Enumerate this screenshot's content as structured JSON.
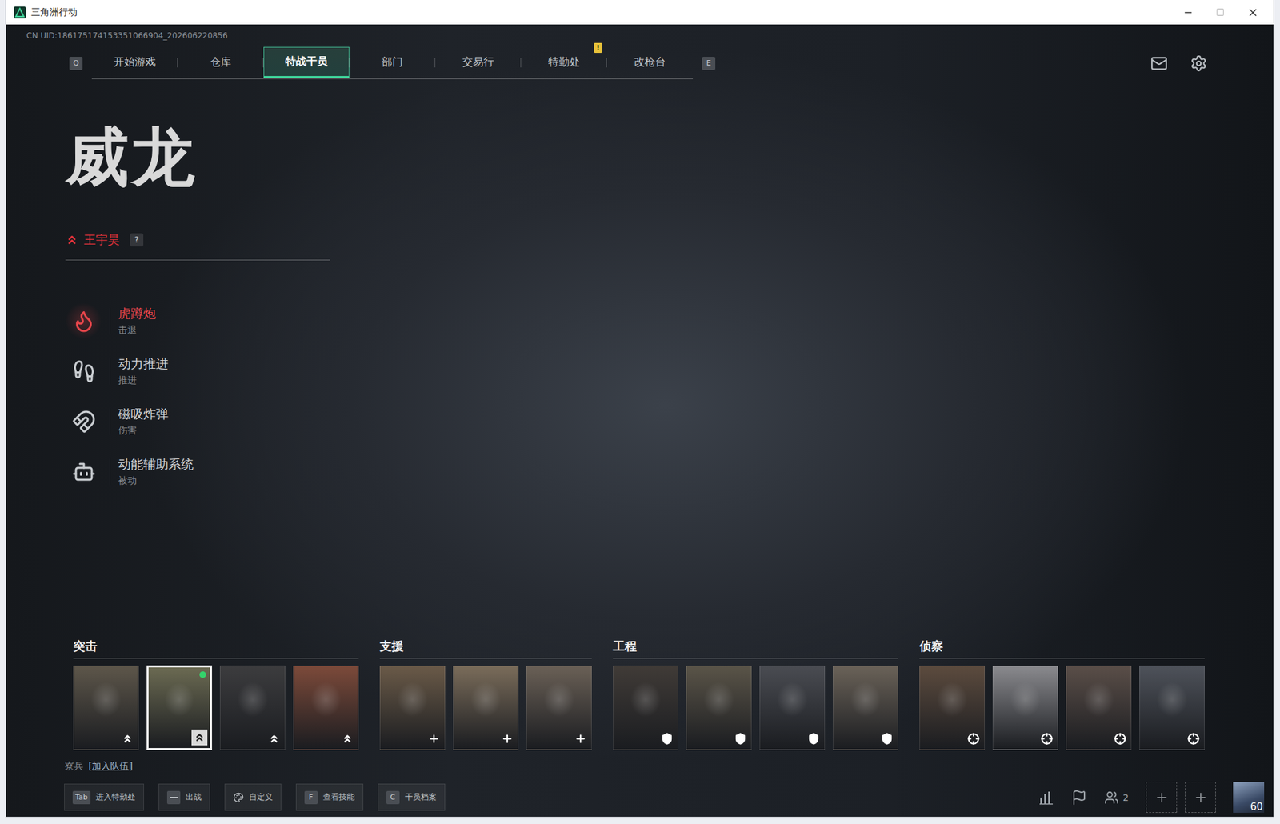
{
  "window": {
    "title": "三角洲行动"
  },
  "uid": "CN UID:186175174153351066904_202606220856",
  "nav": {
    "prev_key": "Q",
    "next_key": "E",
    "tabs": [
      {
        "label": "开始游戏",
        "selected": false,
        "badge": ""
      },
      {
        "label": "仓库",
        "selected": false,
        "badge": ""
      },
      {
        "label": "特战干员",
        "selected": true,
        "badge": ""
      },
      {
        "label": "部门",
        "selected": false,
        "badge": ""
      },
      {
        "label": "交易行",
        "selected": false,
        "badge": ""
      },
      {
        "label": "特勤处",
        "selected": false,
        "badge": "!"
      },
      {
        "label": "改枪台",
        "selected": false,
        "badge": ""
      }
    ]
  },
  "operator": {
    "name": "威龙",
    "real_name": "王宇昊",
    "help": "?",
    "skills": [
      {
        "name": "虎蹲炮",
        "type": "击退",
        "selected": true
      },
      {
        "name": "动力推进",
        "type": "推进",
        "selected": false
      },
      {
        "name": "磁吸炸弹",
        "type": "伤害",
        "selected": false
      },
      {
        "name": "动能辅助系统",
        "type": "被动",
        "selected": false
      }
    ]
  },
  "roster": {
    "groups": [
      {
        "label": "突击",
        "kind": "assault",
        "operators": [
          {
            "selected": false,
            "marked": false,
            "color": "#5d564a"
          },
          {
            "selected": true,
            "marked": true,
            "color": "#6b6a52"
          },
          {
            "selected": false,
            "marked": false,
            "color": "#3c3c3e"
          },
          {
            "selected": false,
            "marked": false,
            "color": "#7c4a3a"
          }
        ]
      },
      {
        "label": "支援",
        "kind": "support",
        "operators": [
          {
            "selected": false,
            "marked": false,
            "color": "#6a5a48"
          },
          {
            "selected": false,
            "marked": false,
            "color": "#7a6c5a"
          },
          {
            "selected": false,
            "marked": false,
            "color": "#6a6056"
          }
        ]
      },
      {
        "label": "工程",
        "kind": "engineer",
        "operators": [
          {
            "selected": false,
            "marked": false,
            "color": "#403b37"
          },
          {
            "selected": false,
            "marked": false,
            "color": "#5a5448"
          },
          {
            "selected": false,
            "marked": false,
            "color": "#4a4c52"
          },
          {
            "selected": false,
            "marked": false,
            "color": "#6a6258"
          }
        ]
      },
      {
        "label": "侦察",
        "kind": "recon",
        "operators": [
          {
            "selected": false,
            "marked": false,
            "color": "#5c4b3e"
          },
          {
            "selected": false,
            "marked": false,
            "color": "#8a8a8e"
          },
          {
            "selected": false,
            "marked": false,
            "color": "#5a4e48"
          },
          {
            "selected": false,
            "marked": false,
            "color": "#4e525a"
          }
        ]
      }
    ]
  },
  "recruit": {
    "label": "寮兵",
    "action": "[加入队伍]"
  },
  "hints": [
    {
      "kind": "key",
      "key": "Tab",
      "label": "进入特勤处"
    },
    {
      "kind": "space",
      "label": "出战"
    },
    {
      "kind": "custom",
      "label": "自定义"
    },
    {
      "kind": "key",
      "key": "F",
      "label": "查看技能"
    },
    {
      "kind": "key",
      "key": "C",
      "label": "干员档案"
    }
  ],
  "squad": {
    "count": "2",
    "level": "60"
  }
}
